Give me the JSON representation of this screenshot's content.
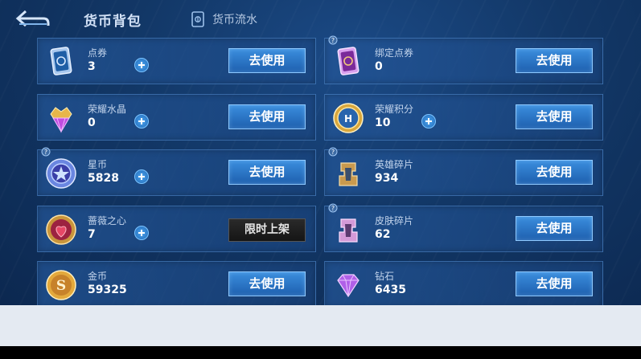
{
  "header": {
    "title": "货币背包",
    "flow_tab": "货币流水"
  },
  "cards": [
    {
      "name": "点券",
      "amount": "3",
      "button": "去使用",
      "icon": "coupon-card-icon"
    },
    {
      "name": "绑定点券",
      "amount": "0",
      "button": "去使用",
      "icon": "bound-coupon-card-icon"
    },
    {
      "name": "荣耀水晶",
      "amount": "0",
      "button": "去使用",
      "icon": "glory-crystal-icon"
    },
    {
      "name": "荣耀积分",
      "amount": "10",
      "button": "去使用",
      "icon": "glory-points-icon"
    },
    {
      "name": "星币",
      "amount": "5828",
      "button": "去使用",
      "icon": "star-coin-icon"
    },
    {
      "name": "英雄碎片",
      "amount": "934",
      "button": "去使用",
      "icon": "hero-fragment-icon"
    },
    {
      "name": "蔷薇之心",
      "amount": "7",
      "button": "限时上架",
      "icon": "rose-heart-icon"
    },
    {
      "name": "皮肤碎片",
      "amount": "62",
      "button": "去使用",
      "icon": "skin-fragment-icon"
    },
    {
      "name": "金币",
      "amount": "59325",
      "button": "去使用",
      "icon": "gold-coin-icon"
    },
    {
      "name": "钻石",
      "amount": "6435",
      "button": "去使用",
      "icon": "diamond-icon"
    }
  ],
  "colors": {
    "accent": "#2f7fd4",
    "background": "#123766",
    "text_muted": "#c2d4ec"
  }
}
